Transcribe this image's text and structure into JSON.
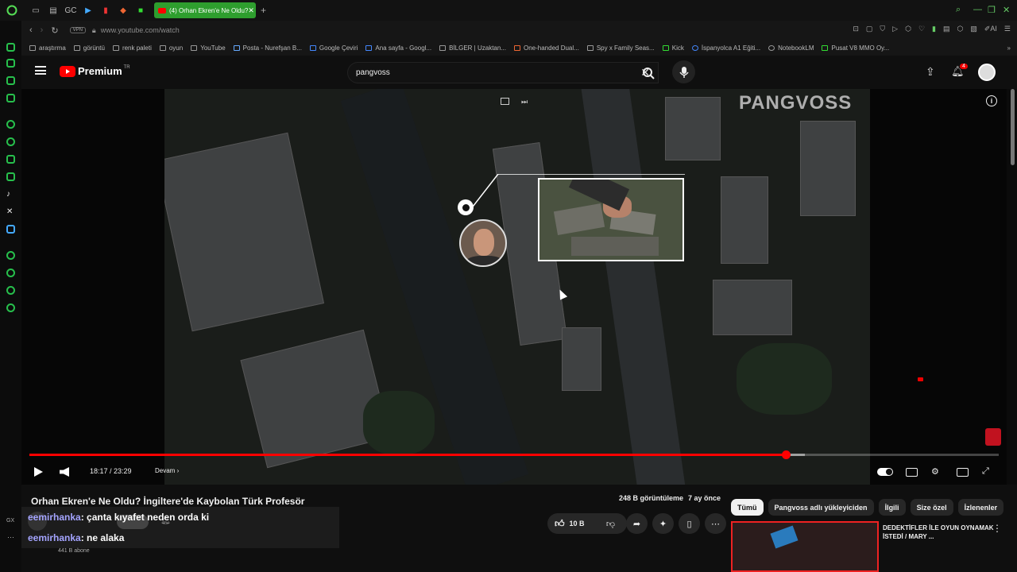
{
  "browser": {
    "tab_title": "(4) Orhan Ekren'e Ne Oldu?",
    "new_tab": "+",
    "url": "www.youtube.com/watch",
    "vpn": "VPN",
    "bookmarks": [
      "araştırma",
      "görüntü",
      "renk paleti",
      "oyun",
      "YouTube",
      "Posta - Nurefşan B...",
      "Google Çeviri",
      "Ana sayfa - Googl...",
      "BİLGER | Uzaktan...",
      "One-handed Dual...",
      "Spy x Family Seas...",
      "Kick",
      "İspanyolca A1 Eğiti...",
      "NotebookLM",
      "Pusat V8 MMO Oy..."
    ],
    "sidebar_bottom": "GX"
  },
  "youtube": {
    "logo_text": "Premium",
    "logo_country": "TR",
    "search_value": "pangvoss",
    "notification_count": "4"
  },
  "player": {
    "watermark": "PANGVOSS",
    "time": "18:17 / 23:29",
    "continue_label": "Devam",
    "progress_played": 0.78,
    "progress_buffered": 0.8
  },
  "video": {
    "title": "Orhan Ekren'e Ne Oldu? İngiltere'de Kaybolan Türk Profesör",
    "views": "248 B görüntüleme",
    "age": "7 ay önce",
    "subscribers": "441 B abone",
    "likes": "10 B"
  },
  "chat": [
    {
      "user": "eemirhanka",
      "message": ": çanta kıyafet neden orda ki"
    },
    {
      "user": "eemirhanka",
      "message": ": ne alaka"
    }
  ],
  "chips": [
    "Tümü",
    "Pangvoss adlı yükleyiciden",
    "İlgili",
    "Size özel",
    "İzlenenler"
  ],
  "recommendation": {
    "title": "DEDEKTİFLER İLE OYUN OYNAMAK İSTEDİ / MARY ..."
  },
  "colors": {
    "accent_green": "#2e9e2e",
    "youtube_red": "#ff0000",
    "chat_user": "#a4a4ff"
  }
}
